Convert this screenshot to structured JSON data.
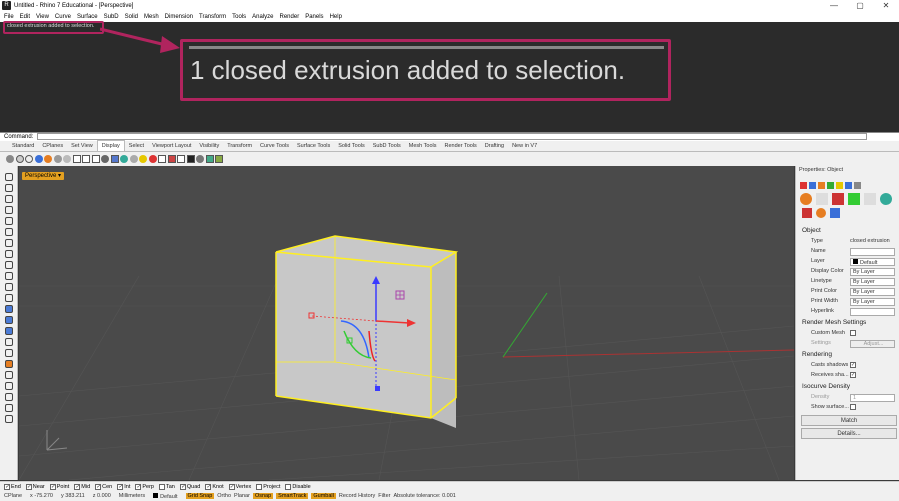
{
  "window": {
    "title": "Untitled - Rhino 7 Educational - [Perspective]",
    "controls": [
      "—",
      "▢",
      "✕"
    ]
  },
  "menu": [
    "File",
    "Edit",
    "View",
    "Curve",
    "Surface",
    "SubD",
    "Solid",
    "Mesh",
    "Dimension",
    "Transform",
    "Tools",
    "Analyze",
    "Render",
    "Panels",
    "Help"
  ],
  "history": {
    "line": "closed extrusion added to selection.",
    "zoomed": "1 closed extrusion added to selection."
  },
  "command": {
    "label": "Command:",
    "value": ""
  },
  "tabs": [
    "Standard",
    "CPlanes",
    "Set View",
    "Display",
    "Select",
    "Viewport Layout",
    "Visibility",
    "Transform",
    "Curve Tools",
    "Surface Tools",
    "Solid Tools",
    "SubD Tools",
    "Mesh Tools",
    "Render Tools",
    "Drafting",
    "New in V7"
  ],
  "viewport": {
    "label": "Perspective",
    "dropdown": "▾"
  },
  "properties": {
    "header": "Properties: Object",
    "section_object": "Object",
    "rows": [
      {
        "label": "Type",
        "value": "closed extrusion"
      },
      {
        "label": "Name",
        "value": ""
      },
      {
        "label": "Layer",
        "value": "Default"
      },
      {
        "label": "Display Color",
        "value": "By Layer"
      },
      {
        "label": "Linetype",
        "value": "By Layer"
      },
      {
        "label": "Print Color",
        "value": "By Layer"
      },
      {
        "label": "Print Width",
        "value": "By Layer"
      },
      {
        "label": "Hyperlink",
        "value": ""
      }
    ],
    "section_mesh": "Render Mesh Settings",
    "custom_mesh": "Custom Mesh",
    "settings": "Settings",
    "adjust": "Adjust...",
    "section_rendering": "Rendering",
    "casts_shadows": "Casts shadows",
    "receives_shadows": "Receives sha...",
    "section_iso": "Isocurve Density",
    "density_label": "Density",
    "density_value": "1",
    "show_surface": "Show surface...",
    "match": "Match",
    "details": "Details..."
  },
  "osnaps": [
    {
      "label": "End",
      "checked": true
    },
    {
      "label": "Near",
      "checked": true
    },
    {
      "label": "Point",
      "checked": true
    },
    {
      "label": "Mid",
      "checked": true
    },
    {
      "label": "Cen",
      "checked": true
    },
    {
      "label": "Int",
      "checked": true
    },
    {
      "label": "Perp",
      "checked": true
    },
    {
      "label": "Tan",
      "checked": false
    },
    {
      "label": "Quad",
      "checked": true
    },
    {
      "label": "Knot",
      "checked": true
    },
    {
      "label": "Vertex",
      "checked": true
    },
    {
      "label": "Project",
      "checked": false
    },
    {
      "label": "Disable",
      "checked": false
    }
  ],
  "status": {
    "cplane": "CPlane",
    "x": "x -75.270",
    "y": "y 383.211",
    "z": "z 0.000",
    "units": "Millimeters",
    "layer": "Default",
    "toggles": [
      {
        "label": "Grid Snap",
        "on": true
      },
      {
        "label": "Ortho",
        "on": false
      },
      {
        "label": "Planar",
        "on": false
      },
      {
        "label": "Osnap",
        "on": true
      },
      {
        "label": "SmartTrack",
        "on": true
      },
      {
        "label": "Gumball",
        "on": true
      },
      {
        "label": "Record History",
        "on": false
      },
      {
        "label": "Filter",
        "on": false
      }
    ],
    "tolerance": "Absolute tolerance: 0.001"
  }
}
